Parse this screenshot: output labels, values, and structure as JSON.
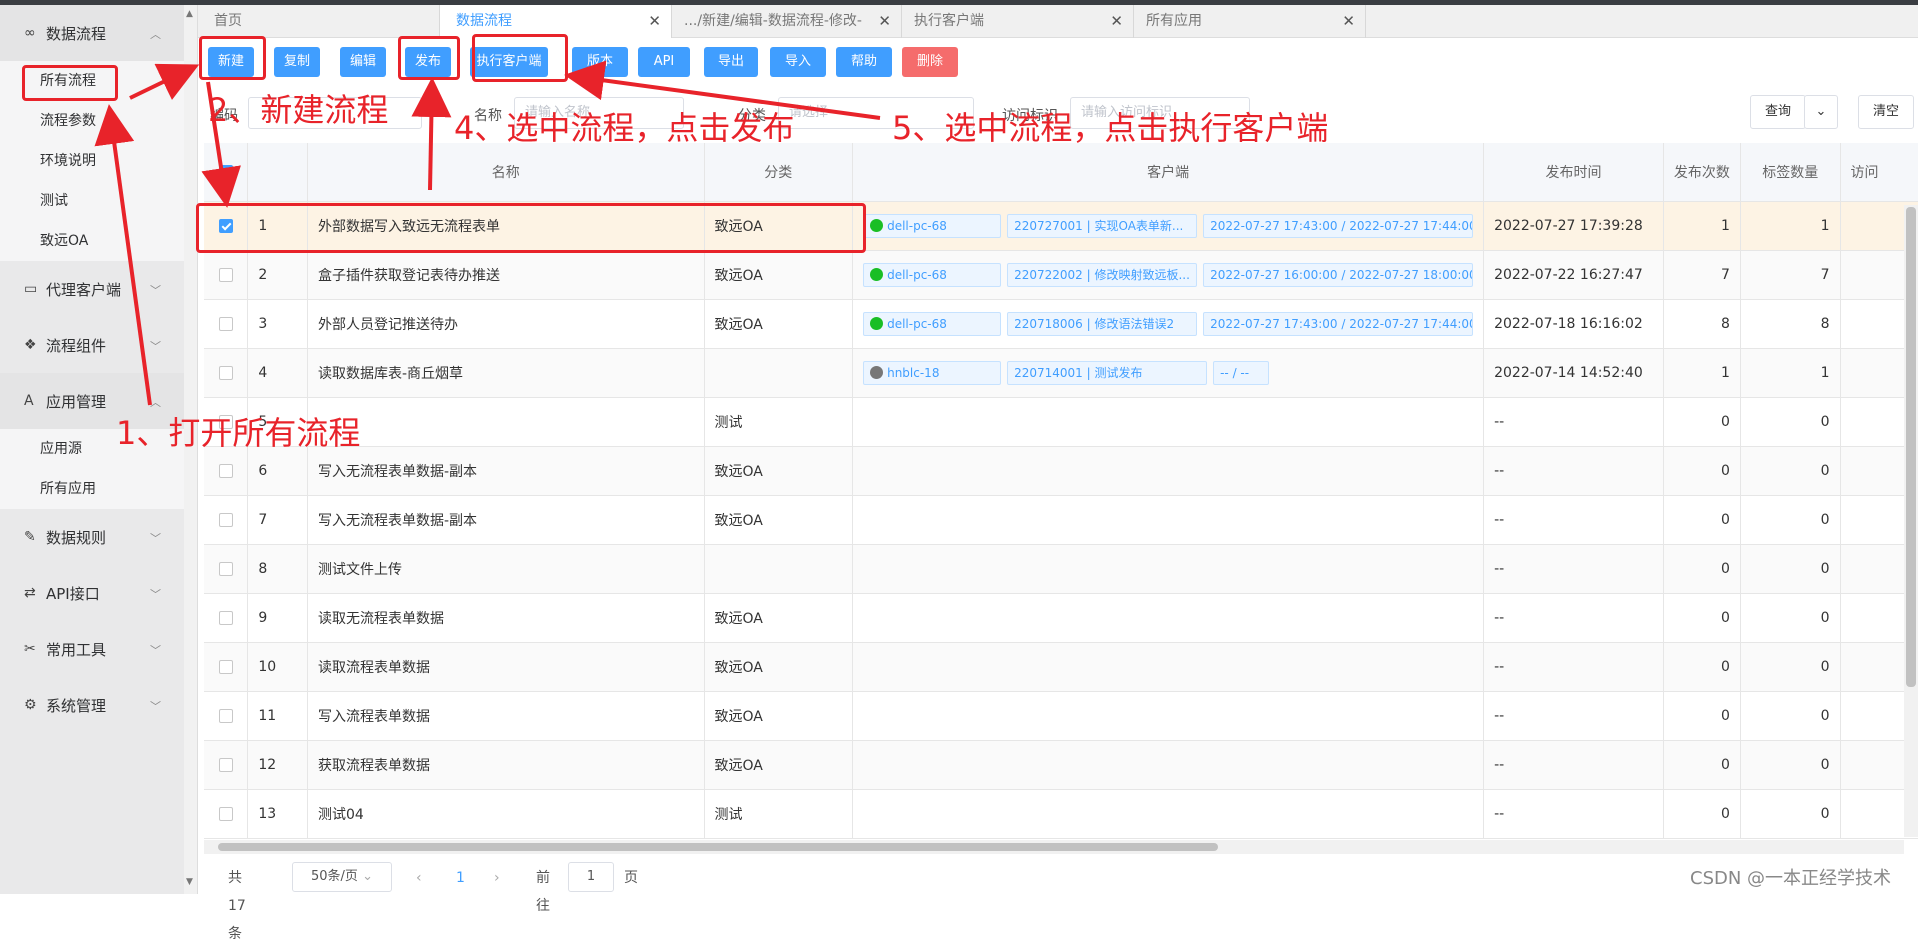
{
  "sidebar": {
    "groups": [
      {
        "label": "数据流程",
        "icon": "infinity-icon",
        "expanded": true,
        "items": [
          "所有流程",
          "流程参数",
          "环境说明",
          "测试",
          "致远OA"
        ]
      },
      {
        "label": "代理客户端",
        "icon": "monitor-icon"
      },
      {
        "label": "流程组件",
        "icon": "components-icon"
      },
      {
        "label": "应用管理",
        "icon": "app-icon",
        "expanded": true,
        "items": [
          "应用源",
          "所有应用"
        ]
      },
      {
        "label": "数据规则",
        "icon": "pencil-icon"
      },
      {
        "label": "API接口",
        "icon": "swap-arrows-icon"
      },
      {
        "label": "常用工具",
        "icon": "tools-icon"
      },
      {
        "label": "系统管理",
        "icon": "gear-icon"
      }
    ]
  },
  "tabs": [
    {
      "label": "首页",
      "closable": false
    },
    {
      "label": "数据流程",
      "closable": true,
      "active": true
    },
    {
      "label": ".../新建/编辑-数据流程-修改-",
      "closable": true
    },
    {
      "label": "执行客户端",
      "closable": true
    },
    {
      "label": "所有应用",
      "closable": true
    }
  ],
  "toolbar": {
    "buttons": [
      "新建",
      "复制",
      "编辑",
      "发布",
      "执行客户端",
      "版本",
      "API",
      "导出",
      "导入",
      "帮助",
      "删除"
    ]
  },
  "filters": {
    "code_label": "编码",
    "name_label": "名称",
    "name_placeholder": "请输入名称",
    "category_label": "分类",
    "category_placeholder": "请选择",
    "access_label": "访问标识",
    "access_placeholder": "请输入访问标识",
    "query_button": "查询",
    "clear_button": "清空"
  },
  "table": {
    "headers": [
      "",
      "",
      "名称",
      "分类",
      "客户端",
      "发布时间",
      "发布次数",
      "标签数量",
      "访问"
    ],
    "rows": [
      {
        "no": "1",
        "name": "外部数据写入致远无流程表单",
        "category": "致远OA",
        "checked": true,
        "client": "dell-pc-68",
        "client_status": "#19be25",
        "version": "220727001 | 实现OA表单新...",
        "window": "2022-07-27 17:43:00 / 2022-07-27 17:44:00",
        "publish_time": "2022-07-27 17:39:28",
        "publish_count": "1",
        "tag_count": "1"
      },
      {
        "no": "2",
        "name": "盒子插件获取登记表待办推送",
        "category": "致远OA",
        "checked": false,
        "client": "dell-pc-68",
        "client_status": "#19be25",
        "version": "220722002 | 修改映射致远板...",
        "window": "2022-07-27 16:00:00 / 2022-07-27 18:00:00",
        "publish_time": "2022-07-22 16:27:47",
        "publish_count": "7",
        "tag_count": "7"
      },
      {
        "no": "3",
        "name": "外部人员登记推送待办",
        "category": "致远OA",
        "checked": false,
        "client": "dell-pc-68",
        "client_status": "#19be25",
        "version": "220718006 | 修改语法错误2",
        "window": "2022-07-27 17:43:00 / 2022-07-27 17:44:00",
        "publish_time": "2022-07-18 16:16:02",
        "publish_count": "8",
        "tag_count": "8"
      },
      {
        "no": "4",
        "name": "读取数据库表-商丘烟草",
        "category": "",
        "checked": false,
        "client": "hnblc-18",
        "client_status": "#777777",
        "version": "220714001 | 测试发布",
        "window": "-- / --",
        "publish_time": "2022-07-14 14:52:40",
        "publish_count": "1",
        "tag_count": "1"
      },
      {
        "no": "5",
        "name": "",
        "category": "测试",
        "checked": false,
        "client": "",
        "publish_time": "--",
        "publish_count": "0",
        "tag_count": "0"
      },
      {
        "no": "6",
        "name": "写入无流程表单数据-副本",
        "category": "致远OA",
        "checked": false,
        "client": "",
        "publish_time": "--",
        "publish_count": "0",
        "tag_count": "0"
      },
      {
        "no": "7",
        "name": "写入无流程表单数据-副本",
        "category": "致远OA",
        "checked": false,
        "client": "",
        "publish_time": "--",
        "publish_count": "0",
        "tag_count": "0"
      },
      {
        "no": "8",
        "name": "测试文件上传",
        "category": "",
        "checked": false,
        "client": "",
        "publish_time": "--",
        "publish_count": "0",
        "tag_count": "0"
      },
      {
        "no": "9",
        "name": "读取无流程表单数据",
        "category": "致远OA",
        "checked": false,
        "client": "",
        "publish_time": "--",
        "publish_count": "0",
        "tag_count": "0"
      },
      {
        "no": "10",
        "name": "读取流程表单数据",
        "category": "致远OA",
        "checked": false,
        "client": "",
        "publish_time": "--",
        "publish_count": "0",
        "tag_count": "0"
      },
      {
        "no": "11",
        "name": "写入流程表单数据",
        "category": "致远OA",
        "checked": false,
        "client": "",
        "publish_time": "--",
        "publish_count": "0",
        "tag_count": "0"
      },
      {
        "no": "12",
        "name": "获取流程表单数据",
        "category": "致远OA",
        "checked": false,
        "client": "",
        "publish_time": "--",
        "publish_count": "0",
        "tag_count": "0"
      },
      {
        "no": "13",
        "name": "测试04",
        "category": "测试",
        "checked": false,
        "client": "",
        "publish_time": "--",
        "publish_count": "0",
        "tag_count": "0"
      }
    ]
  },
  "pagination": {
    "total": "共 17 条",
    "page_size": "50条/页",
    "current": "1",
    "goto_label": "前往",
    "goto_value": "1",
    "page_suffix": "页"
  },
  "annotations": {
    "step1": "1、打开所有流程",
    "step2": "2、新建流程",
    "step4": "4、选中流程，点击发布",
    "step5": "5、选中流程，点击执行客户端"
  },
  "watermark": "CSDN @一本正经学技术",
  "colors": {
    "accent": "#409eff",
    "danger": "#f56c6c",
    "annotation": "#e8232a",
    "highlight_row": "#fdf3e4"
  }
}
